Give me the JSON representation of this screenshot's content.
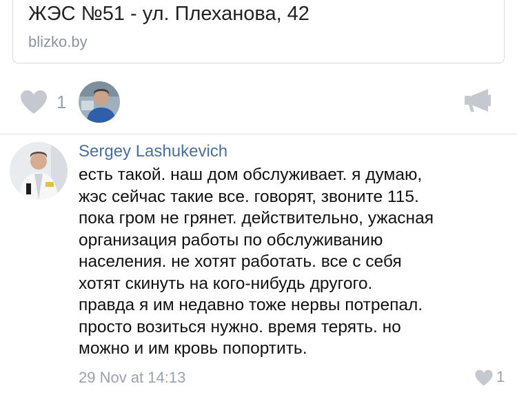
{
  "link_card": {
    "title": "ЖЭС №51 - ул. Плеханова, 42",
    "domain": "blizko.by"
  },
  "actions": {
    "like_icon": "heart-icon",
    "like_count": "1",
    "share_icon": "megaphone-icon"
  },
  "comment": {
    "author": "Sergey Lashukevich",
    "lines": [
      "есть такой. наш дом обслуживает. я думаю,",
      "жэс сейчас такие все. говорят, звоните 115.",
      "пока гром не грянет. действительно, ужасная",
      "организация работы по обслуживанию",
      "населения. не хотят работать. все с себя",
      "хотят скинуть на кого-нибудь другого.",
      "правда я им недавно тоже нервы потрепал.",
      "просто возиться нужно. время терять. но",
      "можно и им кровь попортить."
    ],
    "date": "29 Nov at 14:13",
    "like_count": "1"
  },
  "colors": {
    "author_link": "#4a6f9c",
    "muted": "#9aa1a9",
    "icon": "#c4c9cf"
  }
}
